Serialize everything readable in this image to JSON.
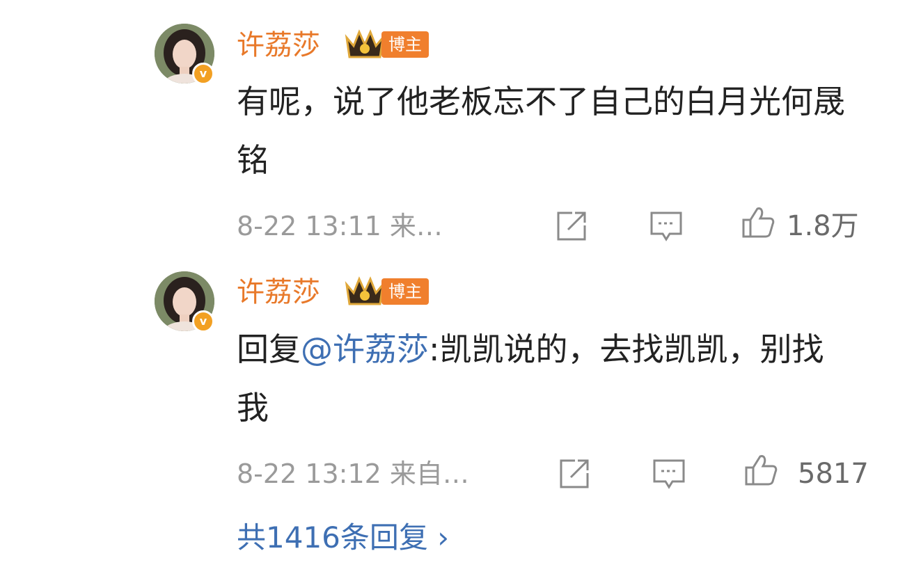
{
  "comments": [
    {
      "username": "许荔莎",
      "author_tag": "博主",
      "text": "有呢，说了他老板忘不了自己的白月光何晟铭",
      "timestamp": "8-22 13:11 来…",
      "likes": "1.8万"
    },
    {
      "username": "许荔莎",
      "author_tag": "博主",
      "reply_prefix": "回复",
      "mention": "@许荔莎",
      "text": ":凯凯说的，去找凯凯，别找我",
      "timestamp": "8-22 13:12 来自…",
      "likes": "5817"
    }
  ],
  "replies_link": "共1416条回复 ›",
  "icons": [
    "avatar-photo",
    "verified-v-icon",
    "crown-icon",
    "share-icon",
    "comment-icon",
    "like-icon",
    "chevron-right-icon"
  ],
  "colors": {
    "username": "#e8792a",
    "tag_bg": "#f07f2d",
    "link": "#3e6fb3",
    "meta": "#9a9a9a"
  }
}
